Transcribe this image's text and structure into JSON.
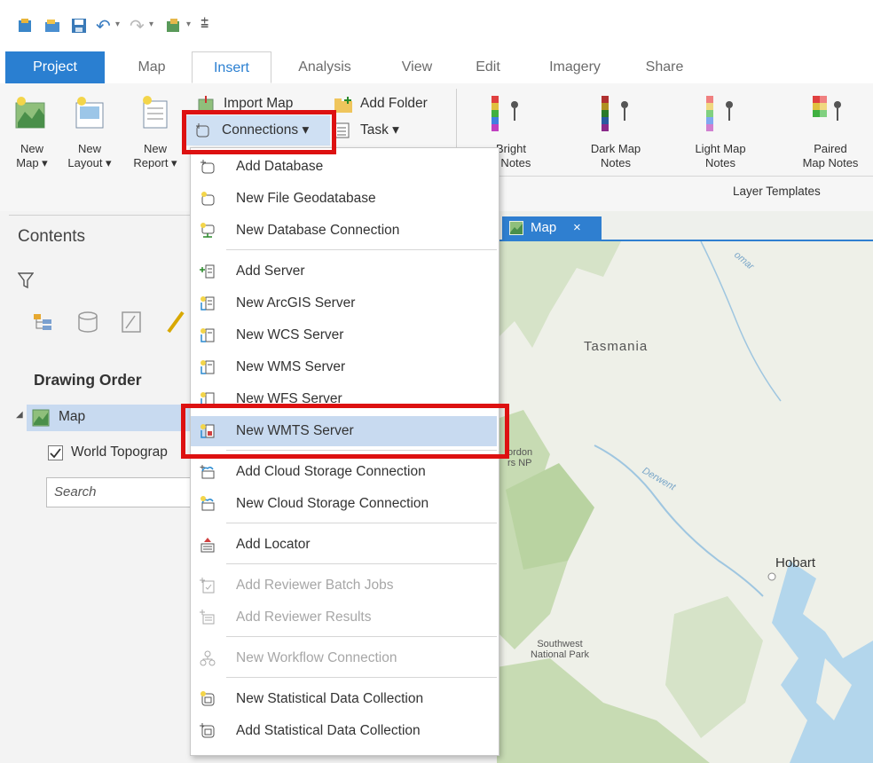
{
  "tabs": {
    "project": "Project",
    "map": "Map",
    "insert": "Insert",
    "analysis": "Analysis",
    "view": "View",
    "edit": "Edit",
    "imagery": "Imagery",
    "share": "Share"
  },
  "ribbon": {
    "new_map_1": "New",
    "new_map_2": "Map ▾",
    "new_layout_1": "New",
    "new_layout_2": "Layout ▾",
    "new_report_1": "New",
    "new_report_2": "Report ▾",
    "import_map": "Import Map",
    "add_folder": "Add Folder",
    "connections": "Connections ▾",
    "task": "Task ▾",
    "bright_1": "Bright",
    "bright_2": "p Notes",
    "dark_1": "Dark Map",
    "dark_2": "Notes",
    "light_1": "Light Map",
    "light_2": "Notes",
    "paired_1": "Paired",
    "paired_2": "Map Notes",
    "layer_templates": "Layer Templates"
  },
  "contents": {
    "title": "Contents",
    "search_placeholder": "Search",
    "drawing_order": "Drawing Order",
    "map_item": "Map",
    "layer_item": "World Topograp"
  },
  "map_view": {
    "tab_label": "Map",
    "close": "×",
    "labels": {
      "tasmania": "Tasmania",
      "hobart": "Hobart",
      "southwest_1": "Southwest",
      "southwest_2": "National Park",
      "gordon_1": "ordon",
      "gordon_2": "rs NP",
      "derwent": "Derwent",
      "lomar": "omar"
    }
  },
  "menu": {
    "items": [
      {
        "label": "Add Database",
        "icon": "add-database-icon"
      },
      {
        "label": "New File Geodatabase",
        "icon": "file-geodatabase-icon"
      },
      {
        "label": "New Database Connection",
        "icon": "database-connection-icon"
      },
      {
        "label": "Add Server",
        "icon": "add-server-icon"
      },
      {
        "label": "New ArcGIS Server",
        "icon": "arcgis-server-icon"
      },
      {
        "label": "New WCS Server",
        "icon": "wcs-server-icon"
      },
      {
        "label": "New WMS Server",
        "icon": "wms-server-icon"
      },
      {
        "label": "New WFS Server",
        "icon": "wfs-server-icon"
      },
      {
        "label": "New WMTS Server",
        "icon": "wmts-server-icon"
      },
      {
        "label": "Add Cloud Storage Connection",
        "icon": "add-cloud-storage-icon"
      },
      {
        "label": "New Cloud Storage Connection",
        "icon": "new-cloud-storage-icon"
      },
      {
        "label": "Add Locator",
        "icon": "locator-icon"
      },
      {
        "label": "Add Reviewer Batch Jobs",
        "icon": "reviewer-batch-jobs-icon"
      },
      {
        "label": "Add Reviewer Results",
        "icon": "reviewer-results-icon"
      },
      {
        "label": "New Workflow Connection",
        "icon": "workflow-connection-icon"
      },
      {
        "label": "New Statistical Data Collection",
        "icon": "new-statistical-data-icon"
      },
      {
        "label": "Add Statistical Data Collection",
        "icon": "add-statistical-data-icon"
      }
    ]
  },
  "colors": {
    "accent": "#2a7fd1",
    "highlight": "#c8daf0",
    "callout_red": "#d11111"
  }
}
